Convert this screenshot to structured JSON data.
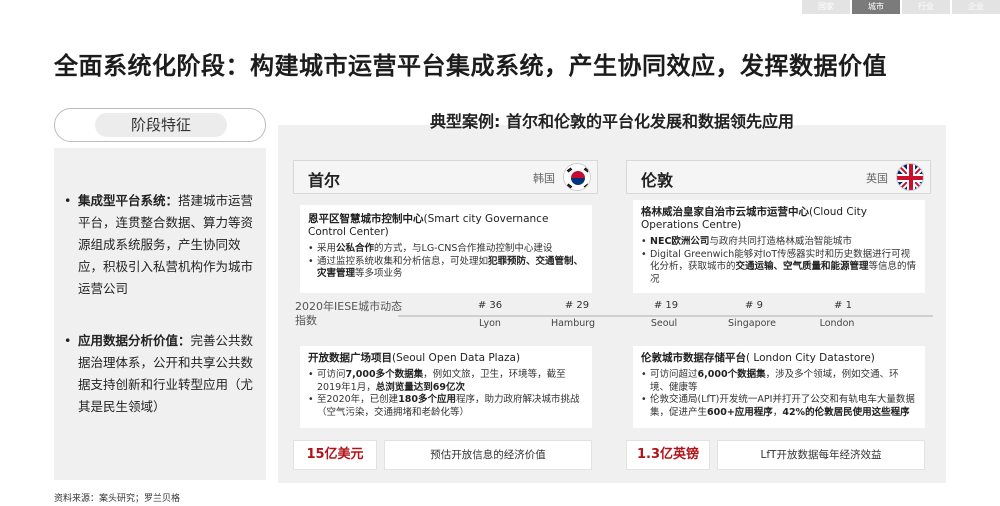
{
  "nav": {
    "tabs": [
      "国家",
      "城市",
      "行业",
      "企业"
    ],
    "active_index": 1
  },
  "title": "全面系统化阶段：构建城市运营平台集成系统，产生协同效应，发挥数据价值",
  "left": {
    "pill_label": "阶段特征",
    "bullets": [
      {
        "bold": "集成型平台系统：",
        "text": "搭建城市运营平台，连贯整合数据、算力等资源组成系统服务，产生协同效应，积极引入私营机构作为城市运营公司"
      },
      {
        "bold": "应用数据分析价值：",
        "text": "完善公共数据治理体系，公开和共享公共数据支持创新和行业转型应用（尤其是民生领域）"
      }
    ]
  },
  "case_title": "典型案例: 首尔和伦敦的平台化发展和数据领先应用",
  "seoul": {
    "city": "首尔",
    "country": "韩国",
    "card1": {
      "title": "恩平区智慧城市控制中心",
      "title_en": "(Smart city Governance Control Center)",
      "b1_pre": "采用",
      "b1_bold": "公私合作",
      "b1_post": "的方式，与LG-CNS合作推动控制中心建设",
      "b2_pre": "通过监控系统收集和分析信息，可处理如",
      "b2_bold1": "犯罪预防、交通管制、灾害管理",
      "b2_post": "等多项业务"
    },
    "card2": {
      "title": "开放数据广场项目",
      "title_en": "(Seoul Open Data Plaza)",
      "b1_pre": "可访问",
      "b1_bold": "7,000多个数据集",
      "b1_mid": "，例如文旅，卫生，环境等，截至2019年1月，",
      "b1_bold2": "总浏览量达到69亿次",
      "b2_pre": "至2020年，已创建",
      "b2_bold": "180多个应用",
      "b2_post": "程序，助力政府解决城市挑战（空气污染，交通拥堵和老龄化等）"
    },
    "value": "15亿美元",
    "value_desc": "预估开放信息的经济价值"
  },
  "london": {
    "city": "伦敦",
    "country": "英国",
    "card1": {
      "title": "格林威治皇家自治市云城市运营中心",
      "title_en": "(Cloud City Operations Centre)",
      "b1_bold": "NEC欧洲公司",
      "b1_post": "与政府共同打造格林威治智能城市",
      "b2_pre": "Digital Greenwich能够对IoT传感器实时和历史数据进行可视化分析，获取城市的",
      "b2_bold": "交通运输、空气质量和能源管理",
      "b2_post": "等信息的情况"
    },
    "card2": {
      "title": "伦敦城市数据存储平台",
      "title_en": "( London City Datastore)",
      "b1_pre": "可访问超过",
      "b1_bold": "6,000个数据集",
      "b1_post": "，涉及多个领域，例如交通、环境、健康等",
      "b2_pre": "伦敦交通局(LfT)开发统一API并打开了公交和有轨电车大量数据集，促进产生",
      "b2_bold": "600+应用程序",
      "b2_mid": "，",
      "b2_bold2": "42%的伦敦居民使用这些程序"
    },
    "value": "1.3亿英镑",
    "value_desc": "LfT开放数据每年经济效益"
  },
  "iese": {
    "label": "2020年IESE城市动态指数",
    "ranks": [
      {
        "rank": "# 36",
        "city": "Lyon"
      },
      {
        "rank": "# 29",
        "city": "Hamburg"
      },
      {
        "rank": "# 19",
        "city": "Seoul"
      },
      {
        "rank": "# 9",
        "city": "Singapore"
      },
      {
        "rank": "# 1",
        "city": "London"
      }
    ]
  },
  "source": "资料来源：案头研究；罗兰贝格",
  "colors": {
    "accent_red": "#b0141a",
    "panel_gray": "#f0f0f0",
    "nav_active": "#7b7b7b"
  }
}
